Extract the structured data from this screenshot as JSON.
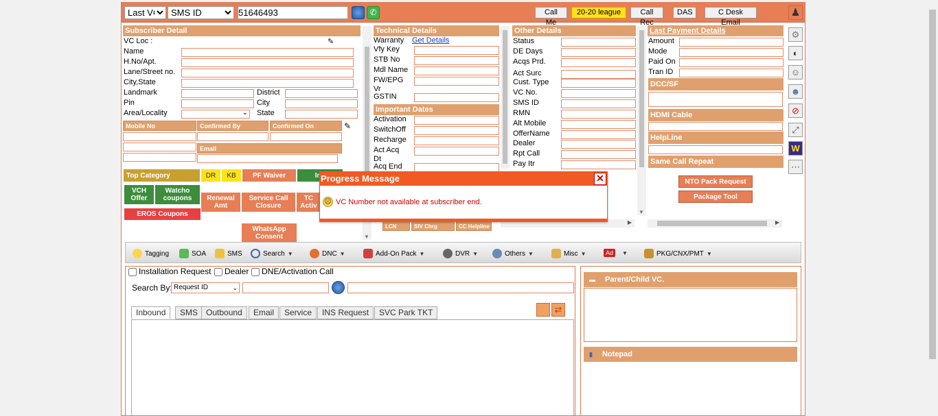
{
  "topbar": {
    "select1": "Last VC",
    "select2": "SMS ID",
    "input_value": "51646493",
    "buttons": [
      "Call Me",
      "20-20 league",
      "Call Rec",
      "DAS",
      "C Desk Email"
    ]
  },
  "subscriber": {
    "title": "Subscriber Detail",
    "labels": [
      "VC Loc :",
      "Name",
      "H.No/Apt.",
      "Lane/Street no.",
      "City,State",
      "Landmark",
      "Pin",
      "Area/Locality"
    ],
    "right_labels": [
      "District",
      "City",
      "State"
    ],
    "table_headers": [
      "Mobile No",
      "Confirmed By",
      "Confirmed On"
    ],
    "email_label": "Email"
  },
  "category": {
    "buttons": [
      "Top Category",
      "DR",
      "KB",
      "PF Waiver",
      "Inv"
    ],
    "row2": [
      "VCH Offer",
      "Watcho coupons",
      "Renewal Amt",
      "Service Call Closure",
      "TC Activ"
    ],
    "eros": "EROS Coupons",
    "whatsapp": "WhatsApp Consent"
  },
  "technical": {
    "title": "Technical Details",
    "warranty_label": "Warranty",
    "warranty_link": "Get Details",
    "labels": [
      "Vfy Key",
      "STB No",
      "Mdl Name",
      "FW/EPG Vr",
      "GSTIN"
    ],
    "important_title": "Important Dates",
    "date_labels": [
      "Activation",
      "SwitchOff",
      "Recharge",
      "Act Acq Dt",
      "Acq End"
    ],
    "bottom_tabs": [
      "LCN",
      "SIV Chrg",
      "CC Helpline"
    ]
  },
  "other": {
    "title": "Other Details",
    "labels": [
      "Status",
      "DE Days",
      "Acqs Prd.",
      "Act Surc",
      "Cust. Type",
      "VC No.",
      "SMS ID",
      "RMN",
      "Alt Mobile",
      "OfferName",
      "Dealer",
      "Rpt Call",
      "Pay Itr"
    ]
  },
  "payment": {
    "title": "Last Payment Details",
    "labels": [
      "Amount",
      "Mode",
      "Paid On",
      "Tran ID"
    ],
    "sections": [
      "DCC/SF",
      "HDMI Cable",
      "HelpLine",
      "Same Call Repeat"
    ],
    "buttons": [
      "NTO Pack Request",
      "Package Tool"
    ]
  },
  "side_icons": [
    "gear-icon",
    "satellite-dish-icon",
    "agent-icon",
    "person-icon",
    "no-entry-icon",
    "expand-icon",
    "w-logo-icon",
    "more-icon"
  ],
  "menu": [
    "Tagging",
    "SOA",
    "SMS",
    "Search",
    "DNC",
    "Add-On Pack",
    "DVR",
    "Others",
    "Misc",
    "Ad",
    "PKG/CNX/PMT"
  ],
  "request": {
    "checks": [
      "Installation Request",
      "Dealer",
      "DNE/Activation Call"
    ],
    "search_by_label": "Search By:",
    "search_by_value": "Request ID",
    "tabs": [
      "Inbound",
      "SMS",
      "Outbound",
      "Email",
      "Service",
      "INS Request",
      "SVC Park TKT"
    ]
  },
  "right_panel": {
    "parent_child": "Parent/Child VC.",
    "notepad": "Notepad"
  },
  "modal": {
    "title": "Progress Message",
    "message": "VC Number not available at subscriber end."
  },
  "colors": {
    "accent": "#e77e55",
    "header": "#e0a06e",
    "modal": "#f05a23",
    "green": "#3c8d3c",
    "red": "#e84040",
    "gold": "#c8a030"
  }
}
